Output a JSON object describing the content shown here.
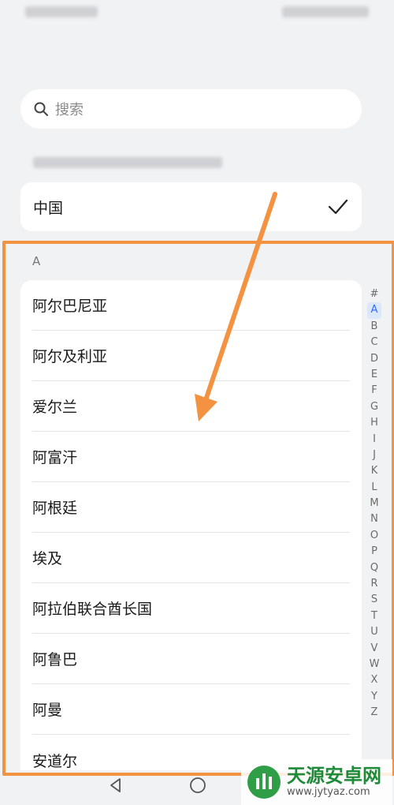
{
  "search": {
    "placeholder": "搜索"
  },
  "current_region": {
    "label": "中国",
    "selected": true
  },
  "section": {
    "letter": "A"
  },
  "countries": [
    "阿尔巴尼亚",
    "阿尔及利亚",
    "爱尔兰",
    "阿富汗",
    "阿根廷",
    "埃及",
    "阿拉伯联合酋长国",
    "阿鲁巴",
    "阿曼",
    "安道尔"
  ],
  "index_letters": [
    "#",
    "A",
    "B",
    "C",
    "D",
    "E",
    "F",
    "G",
    "H",
    "I",
    "J",
    "K",
    "L",
    "M",
    "N",
    "O",
    "P",
    "Q",
    "R",
    "S",
    "T",
    "U",
    "V",
    "W",
    "X",
    "Y",
    "Z"
  ],
  "index_active": "A",
  "watermark": {
    "title": "天源安卓网",
    "url": "www.jytyaz.com"
  },
  "colors": {
    "annotation": "#f39240",
    "accent": "#2a6df4",
    "watermark": "#1f8a3a"
  }
}
